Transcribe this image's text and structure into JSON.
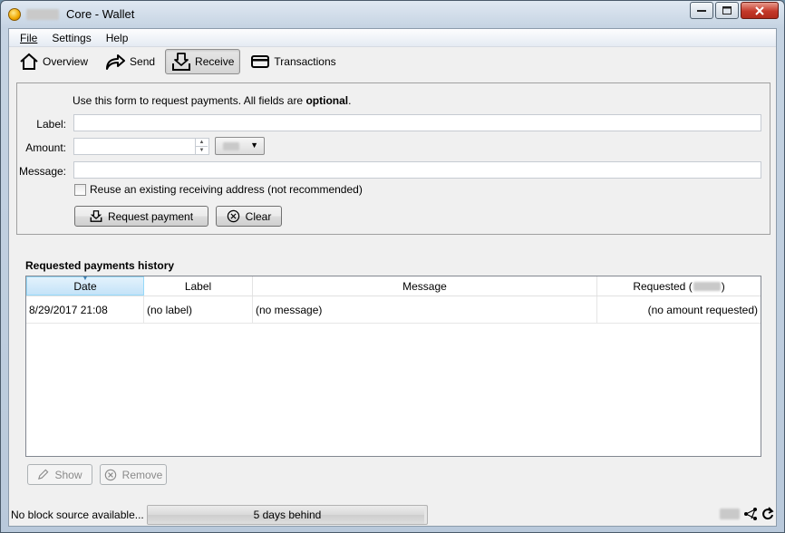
{
  "window": {
    "title": "Core - Wallet",
    "controls": {
      "minimize": "—",
      "maximize": "□",
      "close": "✕"
    }
  },
  "menu": [
    {
      "label": "File"
    },
    {
      "label": "Settings"
    },
    {
      "label": "Help"
    }
  ],
  "toolbar": {
    "overview": "Overview",
    "send": "Send",
    "receive": "Receive",
    "transactions": "Transactions"
  },
  "form": {
    "intro": "Use this form to request payments. All fields are ",
    "intro_bold": "optional",
    "intro_end": ".",
    "label_label": "Label:",
    "label_value": "",
    "amount_label": "Amount:",
    "amount_value": "",
    "message_label": "Message:",
    "message_value": "",
    "reuse_label": "Reuse an existing receiving address (not recommended)",
    "reuse_checked": false,
    "request_button": "Request payment",
    "clear_button": "Clear"
  },
  "history": {
    "title": "Requested payments history",
    "columns": [
      "Date",
      "Label",
      "Message",
      "Requested ("
    ],
    "columns_tail": ")",
    "rows": [
      {
        "date": "8/29/2017 21:08",
        "label": "(no label)",
        "message": "(no message)",
        "requested": "(no amount requested)"
      }
    ],
    "show_button": "Show",
    "remove_button": "Remove"
  },
  "status": {
    "block_source": "No block source available...",
    "sync_text": "5 days behind",
    "sync_progress": 0.99
  },
  "icons": {
    "overview": "home-icon",
    "send": "send-arrow-icon",
    "receive": "receive-inbox-icon",
    "transactions": "card-icon",
    "request": "receive-inbox-icon",
    "clear": "clear-circle-x-icon",
    "show": "pencil-icon",
    "remove": "remove-circle-x-icon",
    "network": "network-icon",
    "sync": "sync-icon"
  }
}
